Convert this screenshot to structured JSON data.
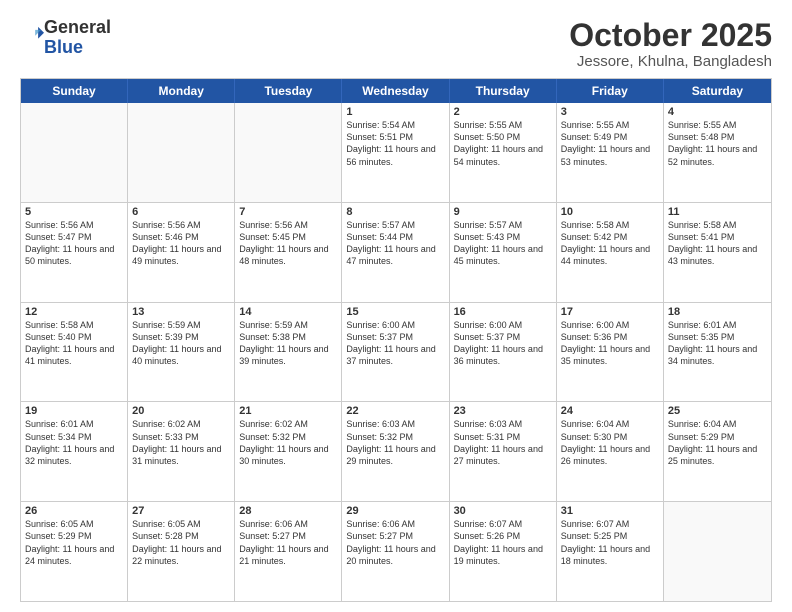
{
  "header": {
    "logo_general": "General",
    "logo_blue": "Blue",
    "month_title": "October 2025",
    "location": "Jessore, Khulna, Bangladesh"
  },
  "calendar": {
    "days_of_week": [
      "Sunday",
      "Monday",
      "Tuesday",
      "Wednesday",
      "Thursday",
      "Friday",
      "Saturday"
    ],
    "weeks": [
      [
        {
          "day": "",
          "info": ""
        },
        {
          "day": "",
          "info": ""
        },
        {
          "day": "",
          "info": ""
        },
        {
          "day": "1",
          "info": "Sunrise: 5:54 AM\nSunset: 5:51 PM\nDaylight: 11 hours and 56 minutes."
        },
        {
          "day": "2",
          "info": "Sunrise: 5:55 AM\nSunset: 5:50 PM\nDaylight: 11 hours and 54 minutes."
        },
        {
          "day": "3",
          "info": "Sunrise: 5:55 AM\nSunset: 5:49 PM\nDaylight: 11 hours and 53 minutes."
        },
        {
          "day": "4",
          "info": "Sunrise: 5:55 AM\nSunset: 5:48 PM\nDaylight: 11 hours and 52 minutes."
        }
      ],
      [
        {
          "day": "5",
          "info": "Sunrise: 5:56 AM\nSunset: 5:47 PM\nDaylight: 11 hours and 50 minutes."
        },
        {
          "day": "6",
          "info": "Sunrise: 5:56 AM\nSunset: 5:46 PM\nDaylight: 11 hours and 49 minutes."
        },
        {
          "day": "7",
          "info": "Sunrise: 5:56 AM\nSunset: 5:45 PM\nDaylight: 11 hours and 48 minutes."
        },
        {
          "day": "8",
          "info": "Sunrise: 5:57 AM\nSunset: 5:44 PM\nDaylight: 11 hours and 47 minutes."
        },
        {
          "day": "9",
          "info": "Sunrise: 5:57 AM\nSunset: 5:43 PM\nDaylight: 11 hours and 45 minutes."
        },
        {
          "day": "10",
          "info": "Sunrise: 5:58 AM\nSunset: 5:42 PM\nDaylight: 11 hours and 44 minutes."
        },
        {
          "day": "11",
          "info": "Sunrise: 5:58 AM\nSunset: 5:41 PM\nDaylight: 11 hours and 43 minutes."
        }
      ],
      [
        {
          "day": "12",
          "info": "Sunrise: 5:58 AM\nSunset: 5:40 PM\nDaylight: 11 hours and 41 minutes."
        },
        {
          "day": "13",
          "info": "Sunrise: 5:59 AM\nSunset: 5:39 PM\nDaylight: 11 hours and 40 minutes."
        },
        {
          "day": "14",
          "info": "Sunrise: 5:59 AM\nSunset: 5:38 PM\nDaylight: 11 hours and 39 minutes."
        },
        {
          "day": "15",
          "info": "Sunrise: 6:00 AM\nSunset: 5:37 PM\nDaylight: 11 hours and 37 minutes."
        },
        {
          "day": "16",
          "info": "Sunrise: 6:00 AM\nSunset: 5:37 PM\nDaylight: 11 hours and 36 minutes."
        },
        {
          "day": "17",
          "info": "Sunrise: 6:00 AM\nSunset: 5:36 PM\nDaylight: 11 hours and 35 minutes."
        },
        {
          "day": "18",
          "info": "Sunrise: 6:01 AM\nSunset: 5:35 PM\nDaylight: 11 hours and 34 minutes."
        }
      ],
      [
        {
          "day": "19",
          "info": "Sunrise: 6:01 AM\nSunset: 5:34 PM\nDaylight: 11 hours and 32 minutes."
        },
        {
          "day": "20",
          "info": "Sunrise: 6:02 AM\nSunset: 5:33 PM\nDaylight: 11 hours and 31 minutes."
        },
        {
          "day": "21",
          "info": "Sunrise: 6:02 AM\nSunset: 5:32 PM\nDaylight: 11 hours and 30 minutes."
        },
        {
          "day": "22",
          "info": "Sunrise: 6:03 AM\nSunset: 5:32 PM\nDaylight: 11 hours and 29 minutes."
        },
        {
          "day": "23",
          "info": "Sunrise: 6:03 AM\nSunset: 5:31 PM\nDaylight: 11 hours and 27 minutes."
        },
        {
          "day": "24",
          "info": "Sunrise: 6:04 AM\nSunset: 5:30 PM\nDaylight: 11 hours and 26 minutes."
        },
        {
          "day": "25",
          "info": "Sunrise: 6:04 AM\nSunset: 5:29 PM\nDaylight: 11 hours and 25 minutes."
        }
      ],
      [
        {
          "day": "26",
          "info": "Sunrise: 6:05 AM\nSunset: 5:29 PM\nDaylight: 11 hours and 24 minutes."
        },
        {
          "day": "27",
          "info": "Sunrise: 6:05 AM\nSunset: 5:28 PM\nDaylight: 11 hours and 22 minutes."
        },
        {
          "day": "28",
          "info": "Sunrise: 6:06 AM\nSunset: 5:27 PM\nDaylight: 11 hours and 21 minutes."
        },
        {
          "day": "29",
          "info": "Sunrise: 6:06 AM\nSunset: 5:27 PM\nDaylight: 11 hours and 20 minutes."
        },
        {
          "day": "30",
          "info": "Sunrise: 6:07 AM\nSunset: 5:26 PM\nDaylight: 11 hours and 19 minutes."
        },
        {
          "day": "31",
          "info": "Sunrise: 6:07 AM\nSunset: 5:25 PM\nDaylight: 11 hours and 18 minutes."
        },
        {
          "day": "",
          "info": ""
        }
      ]
    ]
  }
}
